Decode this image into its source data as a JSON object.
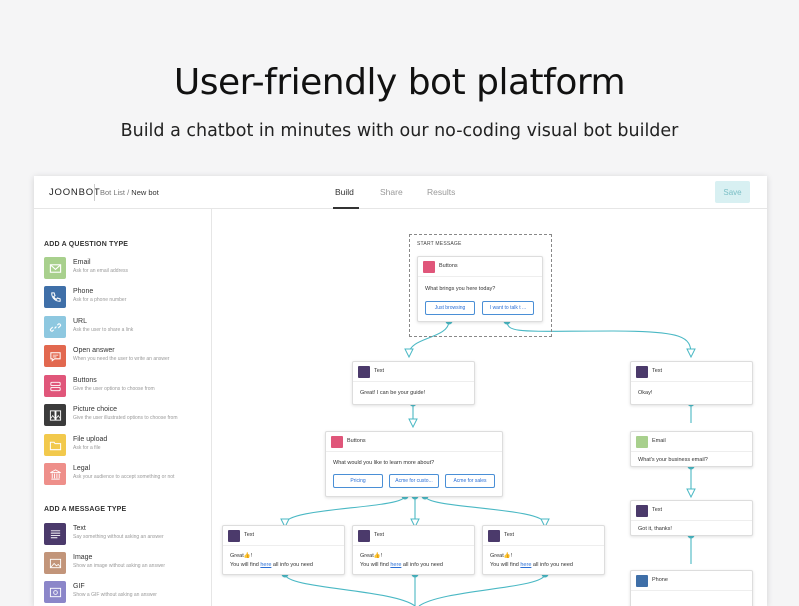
{
  "hero": {
    "title": "User-friendly bot platform",
    "subtitle": "Build a chatbot in minutes with our no-coding visual bot builder"
  },
  "app": {
    "logo": "JOONBOT",
    "breadcrumb_parent": "Bot List",
    "breadcrumb_sep": " / ",
    "breadcrumb_current": "New bot",
    "tabs": [
      {
        "label": "Build",
        "active": true
      },
      {
        "label": "Share",
        "active": false
      },
      {
        "label": "Results",
        "active": false
      }
    ],
    "save_label": "Save"
  },
  "sidebar": {
    "question_header": "ADD A QUESTION TYPE",
    "question_types": [
      {
        "title": "Email",
        "desc": "Ask for an email address",
        "icon": "envelope-icon",
        "color": "#a8d08d"
      },
      {
        "title": "Phone",
        "desc": "Ask for a phone number",
        "icon": "phone-icon",
        "color": "#3f6fa8"
      },
      {
        "title": "URL",
        "desc": "Ask the user to share a link",
        "icon": "link-icon",
        "color": "#8ec8e0"
      },
      {
        "title": "Open answer",
        "desc": "When you need the user to write an answer",
        "icon": "chat-bubble-icon",
        "color": "#e2684f"
      },
      {
        "title": "Buttons",
        "desc": "Give the user options to choose from",
        "icon": "buttons-icon",
        "color": "#e0567a"
      },
      {
        "title": "Picture choice",
        "desc": "Give the user illustrated options to choose from",
        "icon": "picture-choice-icon",
        "color": "#3b3b3b"
      },
      {
        "title": "File upload",
        "desc": "Ask for a file",
        "icon": "folder-icon",
        "color": "#f2c94c"
      },
      {
        "title": "Legal",
        "desc": "Ask your audience to accept something or not",
        "icon": "bank-icon",
        "color": "#ee8f8a"
      }
    ],
    "message_header": "ADD A MESSAGE TYPE",
    "message_types": [
      {
        "title": "Text",
        "desc": "Say something without asking an answer",
        "icon": "text-lines-icon",
        "color": "#4b3a6b"
      },
      {
        "title": "Image",
        "desc": "Show an image without asking an answer",
        "icon": "image-icon",
        "color": "#c2957a"
      },
      {
        "title": "GIF",
        "desc": "Show a GIF without asking an answer",
        "icon": "gif-icon",
        "color": "#8b86c9"
      }
    ]
  },
  "canvas": {
    "start_label": "START MESSAGE",
    "colors": {
      "wire": "#4ab8c4",
      "text_node": "#4b3a6b",
      "buttons_node": "#e0567a",
      "email_node": "#a8d08d",
      "phone_node": "#3f6fa8"
    },
    "start_node": {
      "title": "Buttons",
      "text": "What brings you here today?",
      "options": [
        "Just browsing",
        "I want to talk t ..."
      ]
    },
    "text_guide": {
      "title": "Text",
      "text": "Great! I can be your guide!"
    },
    "buttons_learn": {
      "title": "Buttons",
      "text": "What would you like to learn more about?",
      "options": [
        "Pricing",
        "Acme for custo...",
        "Acme for sales"
      ]
    },
    "text_cards": [
      {
        "title": "Text",
        "line1": "Great👍!",
        "line2_pre": "You will find ",
        "link": "here",
        "line2_post": " all info you need"
      },
      {
        "title": "Text",
        "line1": "Great👍!",
        "line2_pre": "You will find ",
        "link": "here",
        "line2_post": " all info you need"
      },
      {
        "title": "Text",
        "line1": "Great👍!",
        "line2_pre": "You will find ",
        "link": "here",
        "line2_post": " all info you need"
      }
    ],
    "right_text_okay": {
      "title": "Text",
      "text": "Okay!"
    },
    "right_email": {
      "title": "Email",
      "text": "What's your business email?"
    },
    "right_text_thanks": {
      "title": "Text",
      "text": "Got it, thanks!"
    },
    "right_phone": {
      "title": "Phone"
    }
  }
}
